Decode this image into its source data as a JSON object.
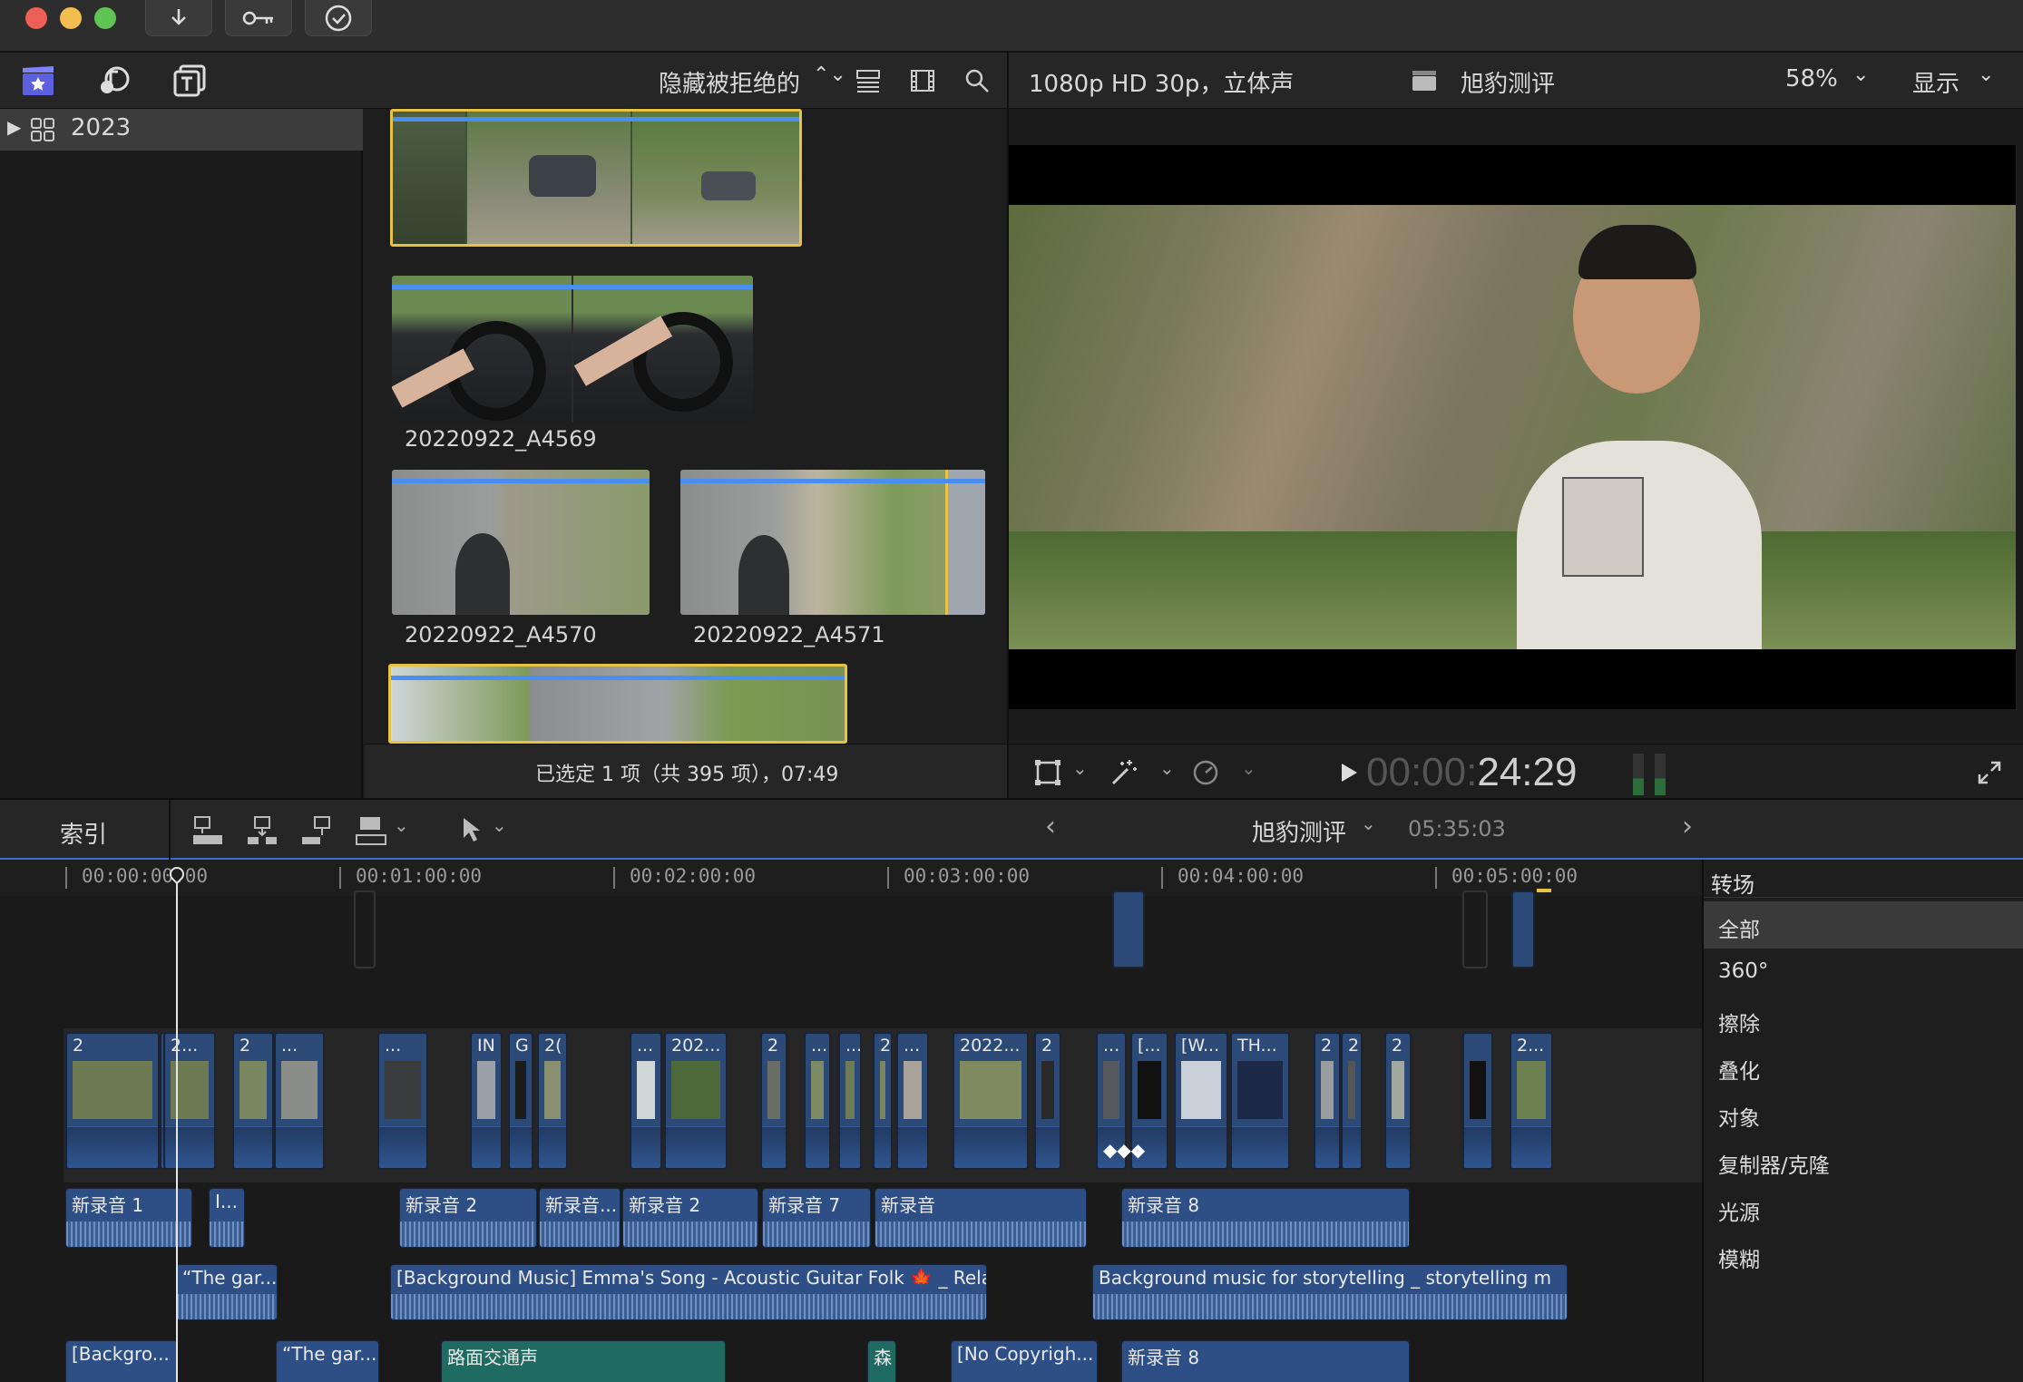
{
  "titlebar": {
    "buttons": [
      "import-icon",
      "key-icon",
      "checkmark-icon"
    ]
  },
  "browser_toolbar": {
    "filter": "隐藏被拒绝的"
  },
  "library": {
    "event": "2023"
  },
  "clips": [
    {
      "name": ""
    },
    {
      "name": "20220922_A4569"
    },
    {
      "name": "20220922_A4570"
    },
    {
      "name": "20220922_A4571"
    },
    {
      "name": ""
    }
  ],
  "selection_status": "已选定 1 项（共 395 项），07:49",
  "viewer": {
    "format": "1080p HD 30p，立体声",
    "project": "旭豹测评",
    "zoom": "58%",
    "display": "显示"
  },
  "playback": {
    "timecode_dim": "00:00:",
    "timecode": "24:29"
  },
  "timeline_toolbar": {
    "index": "索引",
    "project": "旭豹测评",
    "duration": "05:35:03"
  },
  "ruler": [
    "00:00:00:00",
    "00:01:00:00",
    "00:02:00:00",
    "00:03:00:00",
    "00:04:00:00",
    "00:05:00:00"
  ],
  "storyline_labels": [
    "2",
    "2...",
    "2",
    "...",
    "IN",
    "G",
    "2(",
    "...",
    "202...",
    "2",
    "...",
    "2",
    "2022...",
    "2",
    "...",
    "[...",
    "[W...",
    "TH...",
    "2",
    "2",
    "2",
    "2..."
  ],
  "audio_row1": [
    "新录音 1",
    "I...",
    "新录音 2",
    "新录音...",
    "新录音 2",
    "新录音 7",
    "新录音",
    "新录音 8"
  ],
  "audio_row2": [
    "“The gar...",
    "[Background Music] Emma's Song - Acoustic Guitar Folk 🍁 _ Rela...",
    "Background music for storytelling _ storytelling m"
  ],
  "audio_row3": [
    "[Backgro...",
    "“The gar...",
    "路面交通声",
    "森",
    "[No Copyrigh...",
    "新录音 8"
  ],
  "transitions": {
    "header": "转场",
    "items": [
      "全部",
      "360°",
      "擦除",
      "叠化",
      "对象",
      "复制器/克隆",
      "光源",
      "模糊"
    ]
  },
  "colors": {
    "accent": "#4a8ff0",
    "clip_blue": "#2c4a78",
    "audio_blue": "#2d4f86",
    "audio_green": "#1f6b62",
    "selection_yellow": "#e8c343"
  }
}
